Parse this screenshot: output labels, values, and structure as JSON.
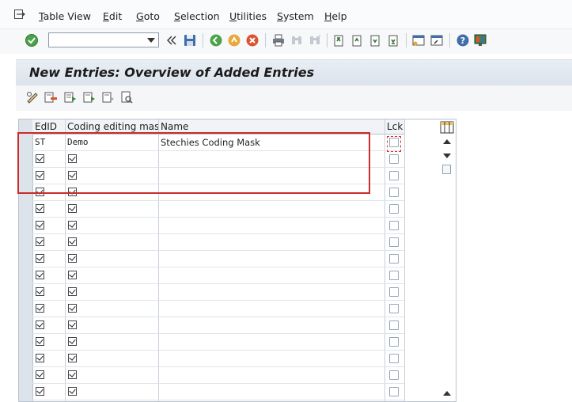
{
  "menu": {
    "items": [
      "Table View",
      "Edit",
      "Goto",
      "Selection",
      "Utilities",
      "System",
      "Help"
    ]
  },
  "toolbar": {
    "command_field_value": "",
    "icons": [
      "enter-icon",
      "back-double-icon",
      "save-icon",
      "back-icon",
      "exit-icon",
      "cancel-icon",
      "print-icon",
      "find-icon",
      "find-next-icon",
      "first-page-icon",
      "previous-page-icon",
      "next-page-icon",
      "last-page-icon",
      "create-session-icon",
      "shortcut-icon",
      "help-icon",
      "layout-icon"
    ]
  },
  "page": {
    "title": "New Entries: Overview of Added Entries"
  },
  "app_toolbar": {
    "icons": [
      "change-display-icon",
      "delete-icon",
      "select-all-icon",
      "select-block-icon",
      "deselect-all-icon",
      "details-icon"
    ]
  },
  "table": {
    "columns": [
      "EdID",
      "Coding editing mask",
      "Name",
      "Lck"
    ],
    "rows": [
      {
        "edid": "ST",
        "mask": "Demo",
        "name": "Stechies Coding Mask",
        "edid_check": false,
        "mask_check": false
      },
      {
        "edid": "",
        "mask": "",
        "name": "",
        "edid_check": true,
        "mask_check": true
      },
      {
        "edid": "",
        "mask": "",
        "name": "",
        "edid_check": true,
        "mask_check": true
      },
      {
        "edid": "",
        "mask": "",
        "name": "",
        "edid_check": true,
        "mask_check": true
      },
      {
        "edid": "",
        "mask": "",
        "name": "",
        "edid_check": true,
        "mask_check": true
      },
      {
        "edid": "",
        "mask": "",
        "name": "",
        "edid_check": true,
        "mask_check": true
      },
      {
        "edid": "",
        "mask": "",
        "name": "",
        "edid_check": true,
        "mask_check": true
      },
      {
        "edid": "",
        "mask": "",
        "name": "",
        "edid_check": true,
        "mask_check": true
      },
      {
        "edid": "",
        "mask": "",
        "name": "",
        "edid_check": true,
        "mask_check": true
      },
      {
        "edid": "",
        "mask": "",
        "name": "",
        "edid_check": true,
        "mask_check": true
      },
      {
        "edid": "",
        "mask": "",
        "name": "",
        "edid_check": true,
        "mask_check": true
      },
      {
        "edid": "",
        "mask": "",
        "name": "",
        "edid_check": true,
        "mask_check": true
      },
      {
        "edid": "",
        "mask": "",
        "name": "",
        "edid_check": true,
        "mask_check": true
      },
      {
        "edid": "",
        "mask": "",
        "name": "",
        "edid_check": true,
        "mask_check": true
      },
      {
        "edid": "",
        "mask": "",
        "name": "",
        "edid_check": true,
        "mask_check": true
      },
      {
        "edid": "",
        "mask": "",
        "name": "",
        "edid_check": true,
        "mask_check": true
      }
    ]
  },
  "colors": {
    "accent": "#cc2b2b",
    "title_bg": "#dbe3ec"
  }
}
